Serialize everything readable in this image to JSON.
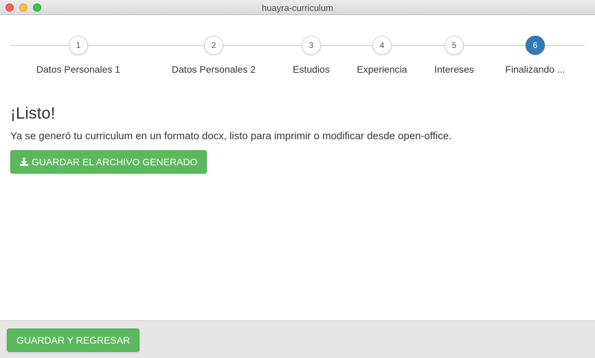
{
  "window": {
    "title": "huayra-curriculum"
  },
  "stepper": {
    "steps": [
      {
        "number": "1",
        "label": "Datos Personales 1",
        "active": false
      },
      {
        "number": "2",
        "label": "Datos Personales 2",
        "active": false
      },
      {
        "number": "3",
        "label": "Estudios",
        "active": false
      },
      {
        "number": "4",
        "label": "Experiencia",
        "active": false
      },
      {
        "number": "5",
        "label": "Intereses",
        "active": false
      },
      {
        "number": "6",
        "label": "Finalizando ...",
        "active": true
      }
    ]
  },
  "main": {
    "heading": "¡Listo!",
    "message": "Ya se generó tu curriculum en un formato docx, listo para imprimir o modificar desde open-office.",
    "download_button": {
      "label": "GUARDAR EL ARCHIVO GENERADO",
      "icon": "download-icon"
    }
  },
  "footer": {
    "save_back_label": "GUARDAR Y REGRESAR"
  },
  "colors": {
    "success": "#5cb85c",
    "active_step": "#337ab7"
  }
}
